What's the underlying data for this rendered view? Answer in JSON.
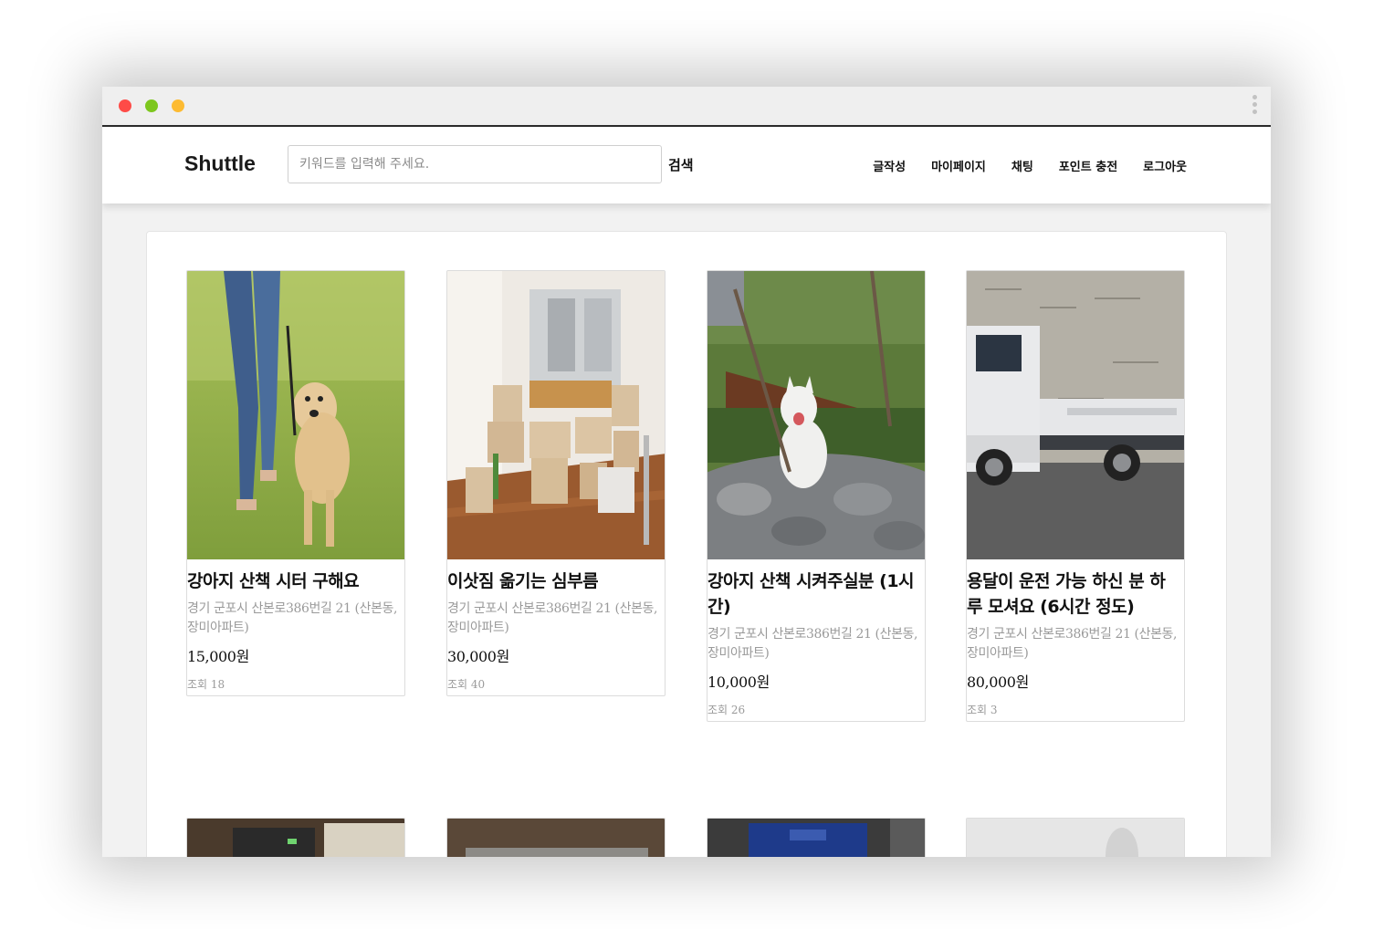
{
  "window": {
    "controls": [
      "close",
      "minimize",
      "zoom"
    ],
    "menu_icon": "kebab-icon"
  },
  "navbar": {
    "brand": "Shuttle",
    "search": {
      "placeholder": "키워드를 입력해 주세요.",
      "value": "",
      "button_label": "검색"
    },
    "menu": [
      "글작성",
      "마이페이지",
      "채팅",
      "포인트 충전",
      "로그아웃"
    ]
  },
  "posts": [
    {
      "title": "강아지 산책 시터 구해요",
      "address": "경기 군포시 산본로386번길 21 (산본동, 장미아파트)",
      "price": "15,000원",
      "views": "조회 18",
      "image": "dog-walking-photo"
    },
    {
      "title": "이삿짐 옮기는 심부름",
      "address": "경기 군포시 산본로386번길 21 (산본동, 장미아파트)",
      "price": "30,000원",
      "views": "조회 40",
      "image": "moving-boxes-photo"
    },
    {
      "title": "강아지 산책 시켜주실분 (1시간)",
      "address": "경기 군포시 산본로386번길 21 (산본동, 장미아파트)",
      "price": "10,000원",
      "views": "조회 26",
      "image": "white-dog-photo"
    },
    {
      "title": "용달이 운전 가능 하신 분 하루 모셔요 (6시간 정도)",
      "address": "경기 군포시 산본로386번길 21 (산본동, 장미아파트)",
      "price": "80,000원",
      "views": "조회 3",
      "image": "truck-photo"
    }
  ],
  "partial_posts": [
    {
      "image": "desk-equipment-photo"
    },
    {
      "image": "box-photo"
    },
    {
      "image": "screen-photo"
    },
    {
      "image": "white-object-photo"
    }
  ]
}
